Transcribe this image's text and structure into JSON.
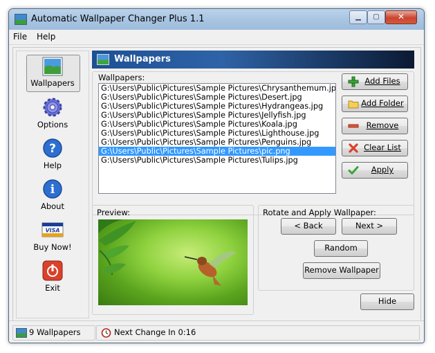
{
  "window": {
    "title": "Automatic Wallpaper Changer Plus 1.1"
  },
  "menu": {
    "items": [
      "File",
      "Help"
    ]
  },
  "sidebar": {
    "items": [
      {
        "label": "Wallpapers",
        "icon": "landscape-icon",
        "active": true
      },
      {
        "label": "Options",
        "icon": "gear-icon"
      },
      {
        "label": "Help",
        "icon": "help-icon"
      },
      {
        "label": "About",
        "icon": "info-icon"
      },
      {
        "label": "Buy Now!",
        "icon": "visa-card-icon"
      },
      {
        "label": "Exit",
        "icon": "power-icon"
      }
    ]
  },
  "header": {
    "title": "Wallpapers"
  },
  "wallpapers": {
    "label": "Wallpapers:",
    "items": [
      "G:\\Users\\Public\\Pictures\\Sample Pictures\\Chrysanthemum.jpg",
      "G:\\Users\\Public\\Pictures\\Sample Pictures\\Desert.jpg",
      "G:\\Users\\Public\\Pictures\\Sample Pictures\\Hydrangeas.jpg",
      "G:\\Users\\Public\\Pictures\\Sample Pictures\\Jellyfish.jpg",
      "G:\\Users\\Public\\Pictures\\Sample Pictures\\Koala.jpg",
      "G:\\Users\\Public\\Pictures\\Sample Pictures\\Lighthouse.jpg",
      "G:\\Users\\Public\\Pictures\\Sample Pictures\\Penguins.jpg",
      "G:\\Users\\Public\\Pictures\\Sample Pictures\\pic.png",
      "G:\\Users\\Public\\Pictures\\Sample Pictures\\Tulips.jpg"
    ],
    "selected_index": 7
  },
  "buttons": {
    "add_files": "Add Files",
    "add_folder": "Add Folder",
    "remove": "Remove",
    "clear_list": "Clear List",
    "apply": "Apply"
  },
  "preview": {
    "label": "Preview:"
  },
  "rotate": {
    "label": "Rotate and Apply Wallpaper:",
    "back": "< Back",
    "next": "Next >",
    "random": "Random",
    "remove_wallpaper": "Remove Wallpaper"
  },
  "hide": "Hide",
  "status": {
    "count": "9 Wallpapers",
    "next_change": "Next Change In 0:16"
  },
  "colors": {
    "header_start": "#1d4f93",
    "header_end": "#0b1a33",
    "selection": "#3399ff"
  }
}
